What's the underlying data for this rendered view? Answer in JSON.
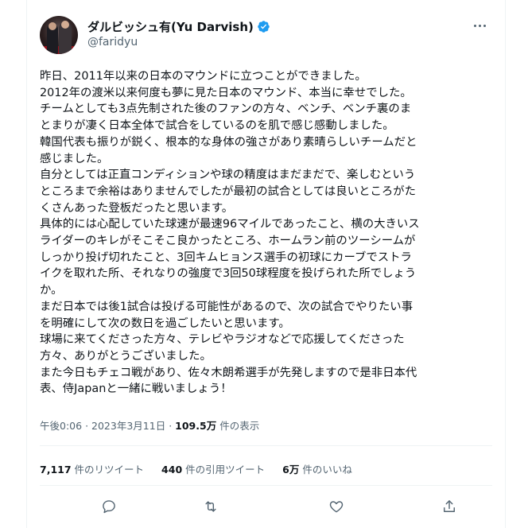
{
  "user": {
    "display_name": "ダルビッシュ有(Yu Darvish)",
    "handle": "@faridyu"
  },
  "tweet": {
    "lines": [
      "昨日、2011年以来の日本のマウンドに立つことができました。",
      "2012年の渡米以来何度も夢に見た日本のマウンド、本当に幸せでした。",
      "チームとしても3点先制された後のファンの方々、ベンチ、ベンチ裏のま",
      "とまりが凄く日本全体で試合をしているのを肌で感じ感動しました。",
      "韓国代表も振りが鋭く、根本的な身体の強さがあり素晴らしいチームだと",
      "感じました。",
      "自分としては正直コンディションや球の精度はまだまだで、楽しむという",
      "ところまで余裕はありませんでしたが最初の試合としては良いところがた",
      "くさんあった登板だったと思います。",
      "具体的には心配していた球速が最速96マイルであったこと、横の大きいス",
      "ライダーのキレがそこそこ良かったところ、ホームラン前のツーシームが",
      "しっかり投げ切れたこと、3回キムヒョンス選手の初球にカーブでストラ",
      "イクを取れた所、それなりの強度で3回50球程度を投げられた所でしょう",
      "か。",
      "まだ日本では後1試合は投げる可能性があるので、次の試合でやりたい事",
      "を明確にして次の数日を過ごしたいと思います。",
      "球場に来てくださった方々、テレビやラジオなどで応援してくださった",
      "方々、ありがとうございました。",
      "また今日もチェコ戦があり、佐々木朗希選手が先発しますので是非日本代",
      "表、侍Japanと一緒に戦いましょう！"
    ]
  },
  "meta": {
    "time": "午後0:06",
    "dot": "·",
    "date": "2023年3月11日",
    "views_count": "109.5万",
    "views_label": "件の表示"
  },
  "stats": {
    "retweets_count": "7,117",
    "retweets_label": "件のリツイート",
    "quotes_count": "440",
    "quotes_label": "件の引用ツイート",
    "likes_count": "6万",
    "likes_label": "件のいいね"
  },
  "icons": {
    "verified": "verified-badge-icon",
    "more": "more-icon",
    "reply": "reply-icon",
    "retweet": "retweet-icon",
    "like": "like-icon",
    "share": "share-icon"
  },
  "colors": {
    "verified_blue": "#1d9bf0",
    "text": "#0f1419",
    "secondary": "#536471",
    "divider": "#eff3f4"
  }
}
